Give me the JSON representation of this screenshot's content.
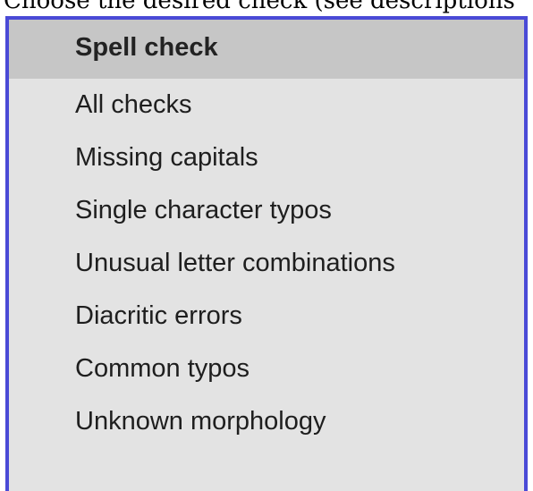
{
  "caption": "Choose the desired check (see descriptions",
  "dropdown": {
    "header": "Spell check",
    "items": [
      {
        "label": "All checks"
      },
      {
        "label": "Missing capitals"
      },
      {
        "label": "Single character typos"
      },
      {
        "label": "Unusual letter combinations"
      },
      {
        "label": "Diacritic errors"
      },
      {
        "label": "Common typos"
      },
      {
        "label": "Unknown morphology"
      }
    ]
  },
  "colors": {
    "border": "#4a4ad6",
    "header_background": "#c6c6c6",
    "list_background": "#e3e3e3"
  }
}
